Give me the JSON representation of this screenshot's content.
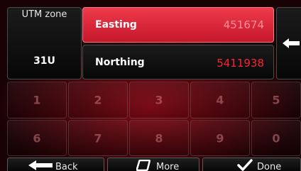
{
  "utm": {
    "label": "UTM zone",
    "value": "31U"
  },
  "easting": {
    "label": "Easting",
    "value": "451674"
  },
  "northing": {
    "label": "Northing",
    "value": "5411938"
  },
  "keypad": {
    "row1": [
      "1",
      "2",
      "3",
      "4",
      "5"
    ],
    "row2": [
      "6",
      "7",
      "8",
      "9",
      "0"
    ]
  },
  "buttons": {
    "back": "Back",
    "more": "More",
    "done": "Done"
  },
  "colors": {
    "accent": "#e8293b",
    "background": "#0c0102",
    "value_text": "#ff2233"
  },
  "icons": {
    "backspace": "backspace-arrow-icon",
    "back": "arrow-left-icon",
    "more": "more-icon",
    "done": "checkmark-icon"
  }
}
